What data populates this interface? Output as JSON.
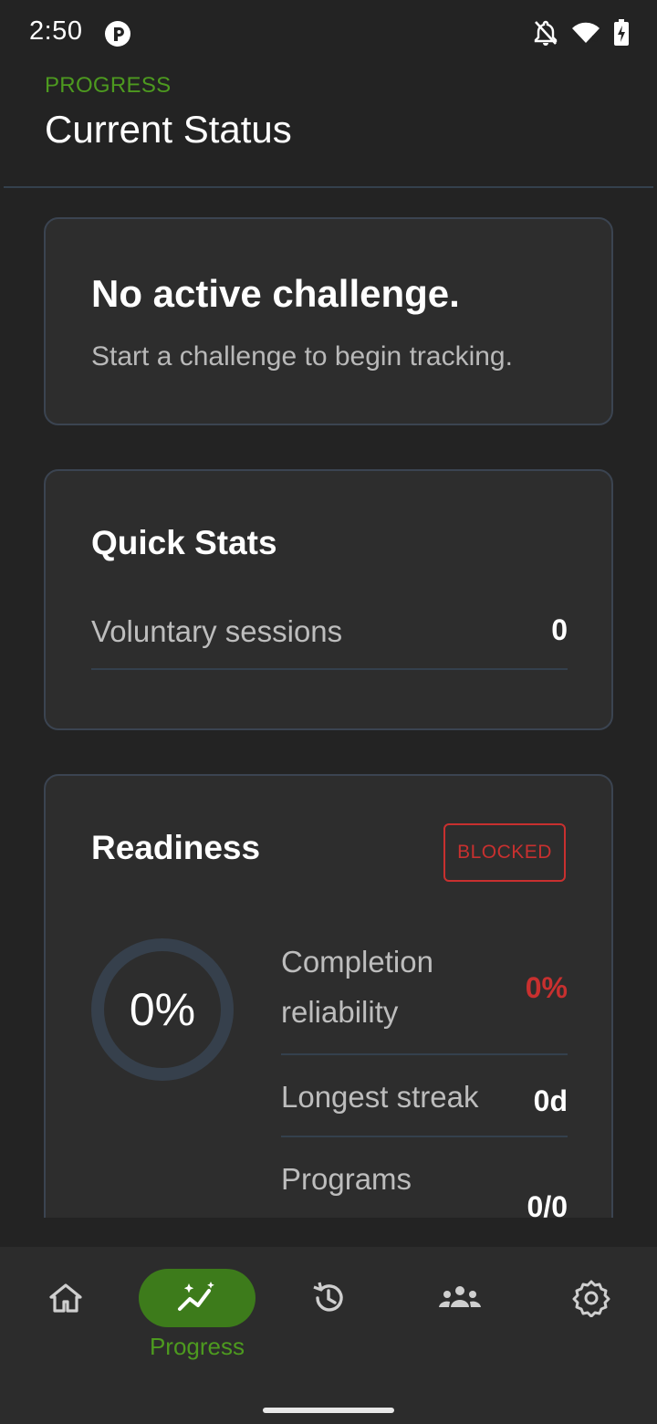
{
  "status_bar": {
    "time": "2:50",
    "icons": [
      "app-status-icon",
      "notifications-off-icon",
      "wifi-icon",
      "battery-charging-icon"
    ]
  },
  "header": {
    "overline": "PROGRESS",
    "title": "Current Status"
  },
  "challenge_card": {
    "headline": "No active challenge.",
    "subtext": "Start a challenge to begin tracking."
  },
  "quick_stats": {
    "title": "Quick Stats",
    "rows": [
      {
        "label": "Voluntary sessions",
        "value": "0"
      }
    ]
  },
  "readiness": {
    "title": "Readiness",
    "badge": "BLOCKED",
    "ring_value": "0%",
    "ring_fraction": 0,
    "metrics": [
      {
        "label_line1": "Completion",
        "label_line2": "reliability",
        "value": "0%"
      },
      {
        "label": "Longest streak",
        "value": "0d"
      },
      {
        "label_line1": "Programs",
        "value": "0/0"
      }
    ]
  },
  "bottom_nav": {
    "items": [
      {
        "icon": "home-icon",
        "label": ""
      },
      {
        "icon": "progress-icon",
        "label": "Progress",
        "active": true
      },
      {
        "icon": "history-icon",
        "label": ""
      },
      {
        "icon": "community-icon",
        "label": ""
      },
      {
        "icon": "settings-icon",
        "label": ""
      }
    ]
  },
  "colors": {
    "accent": "#4d9a1f",
    "active_pill": "#3d7b1b",
    "danger": "#c8302f",
    "background": "#232323",
    "card": "#2d2d2d"
  }
}
